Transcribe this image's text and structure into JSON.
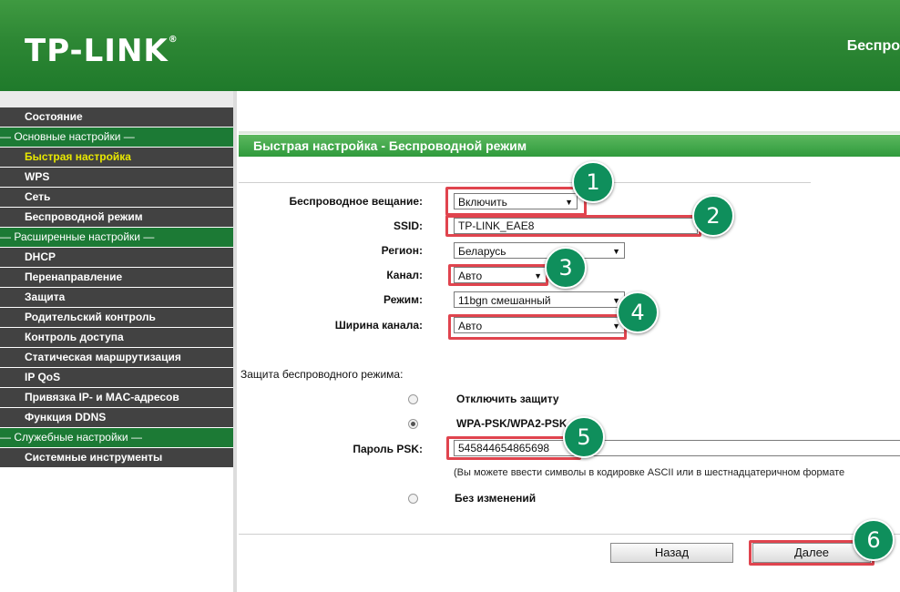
{
  "header": {
    "logo": "TP-LINK",
    "logo_mark": "®",
    "section_title": "Беспро"
  },
  "sidebar": {
    "items": [
      {
        "label": "Состояние",
        "type": "item"
      },
      {
        "label": "— Основные настройки —",
        "type": "group"
      },
      {
        "label": "Быстрая настройка",
        "type": "item",
        "active": true
      },
      {
        "label": "WPS",
        "type": "item"
      },
      {
        "label": "Сеть",
        "type": "item"
      },
      {
        "label": "Беспроводной режим",
        "type": "item"
      },
      {
        "label": "— Расширенные настройки —",
        "type": "group"
      },
      {
        "label": "DHCP",
        "type": "item"
      },
      {
        "label": "Перенаправление",
        "type": "item"
      },
      {
        "label": "Защита",
        "type": "item"
      },
      {
        "label": "Родительский контроль",
        "type": "item"
      },
      {
        "label": "Контроль доступа",
        "type": "item"
      },
      {
        "label": "Статическая маршрутизация",
        "type": "item"
      },
      {
        "label": "IP QoS",
        "type": "item"
      },
      {
        "label": "Привязка IP- и MAC-адресов",
        "type": "item"
      },
      {
        "label": "Функция DDNS",
        "type": "item"
      },
      {
        "label": "— Служебные настройки —",
        "type": "group"
      },
      {
        "label": "Системные инструменты",
        "type": "item"
      }
    ]
  },
  "main": {
    "title": "Быстрая настройка - Беспроводной режим",
    "form": {
      "broadcast_label": "Беспроводное вещание:",
      "broadcast_value": "Включить",
      "ssid_label": "SSID:",
      "ssid_value": "TP-LINK_EAE8",
      "region_label": "Регион:",
      "region_value": "Беларусь",
      "channel_label": "Канал:",
      "channel_value": "Авто",
      "mode_label": "Режим:",
      "mode_value": "11bgn смешанный",
      "width_label": "Ширина канала:",
      "width_value": "Авто"
    },
    "security": {
      "heading": "Защита беспроводного режима:",
      "opt_disable": "Отключить защиту",
      "opt_wpa": "WPA-PSK/WPA2-PSK",
      "psk_label": "Пароль PSK:",
      "psk_value": "545844654865698",
      "psk_hint": "(Вы можете ввести символы в кодировке ASCII или в шестнадцатеричном формате",
      "opt_nochange": "Без изменений"
    },
    "buttons": {
      "back": "Назад",
      "next": "Далее"
    }
  },
  "annotations": [
    "1",
    "2",
    "3",
    "4",
    "5",
    "6"
  ],
  "colors": {
    "header_green": "#2d8734",
    "menu_bg": "#424242",
    "group_green": "#1c7a35",
    "active_text": "#e8e800",
    "marker_red": "#e0444e",
    "badge_green": "#0f8f5c"
  }
}
